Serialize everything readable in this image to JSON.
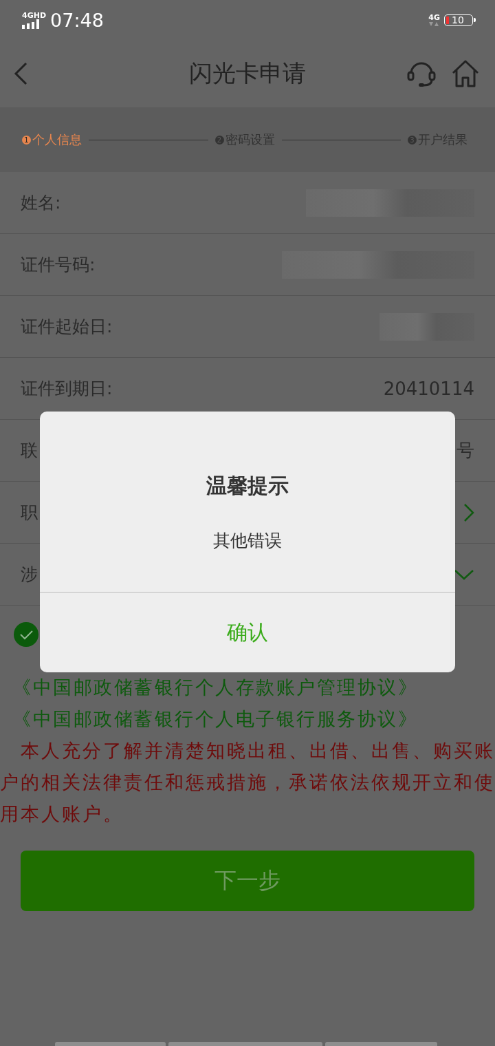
{
  "status_bar": {
    "network_left": "4GHD",
    "time": "07:48",
    "network_right": "4G",
    "battery": "10"
  },
  "header": {
    "title": "闪光卡申请"
  },
  "steps": [
    {
      "number": "1",
      "label": "个人信息",
      "selected": true
    },
    {
      "number": "2",
      "label": "密码设置",
      "selected": false
    },
    {
      "number": "3",
      "label": "开户结果",
      "selected": false
    }
  ],
  "form_rows": [
    {
      "kind": "redacted",
      "label": "姓名:"
    },
    {
      "kind": "redacted",
      "label": "证件号码:"
    },
    {
      "kind": "redacted",
      "label": "证件起始日:"
    },
    {
      "kind": "text",
      "label": "证件到期日:",
      "value": "20410114"
    },
    {
      "kind": "text",
      "label": "联",
      "value": "号"
    },
    {
      "kind": "select",
      "label": "职"
    },
    {
      "kind": "dropdown",
      "label": "涉"
    }
  ],
  "agreement": {
    "checked": true,
    "links": [
      "《中国邮政储蓄银行个人存款账户管理协议》",
      "《中国邮政储蓄银行个人电子银行服务协议》"
    ],
    "notice": "本人充分了解并清楚知晓出租、出借、出售、购买账户的相关法律责任和惩戒措施，承诺依法依规开立和使用本人账户。"
  },
  "next_button": {
    "label": "下一步"
  },
  "dialog": {
    "title": "温馨提示",
    "message": "其他错误",
    "confirm": "确认"
  }
}
